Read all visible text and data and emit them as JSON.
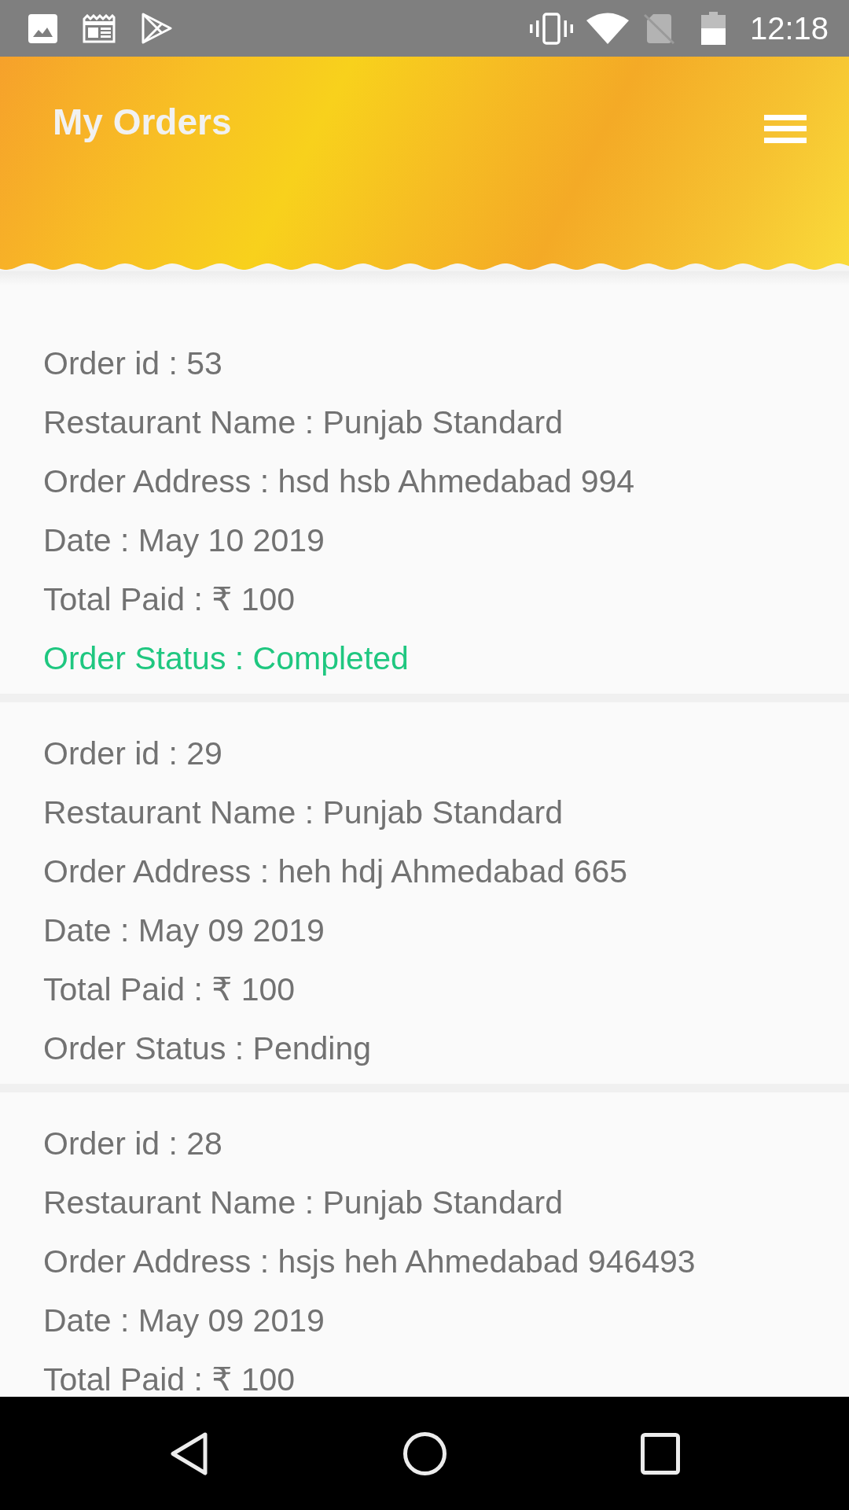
{
  "status_bar": {
    "time": "12:18"
  },
  "header": {
    "title": "My Orders"
  },
  "orders": [
    {
      "order_id": "Order id : 53",
      "restaurant": "Restaurant Name : Punjab Standard",
      "address": "Order Address : hsd hsb Ahmedabad 994",
      "date": "Date : May 10 2019",
      "total_paid": "Total Paid : ₹ 100",
      "status": {
        "text": "Order Status : Completed",
        "completed": true
      }
    },
    {
      "order_id": "Order id : 29",
      "restaurant": "Restaurant Name : Punjab Standard",
      "address": "Order Address : heh hdj Ahmedabad 665",
      "date": "Date : May 09 2019",
      "total_paid": "Total Paid : ₹ 100",
      "status": {
        "text": "Order Status : Pending",
        "completed": false
      }
    },
    {
      "order_id": "Order id : 28",
      "restaurant": "Restaurant Name : Punjab Standard",
      "address": "Order Address : hsjs heh Ahmedabad 946493",
      "date": "Date : May 09 2019",
      "total_paid": "Total Paid : ₹ 100"
    }
  ]
}
